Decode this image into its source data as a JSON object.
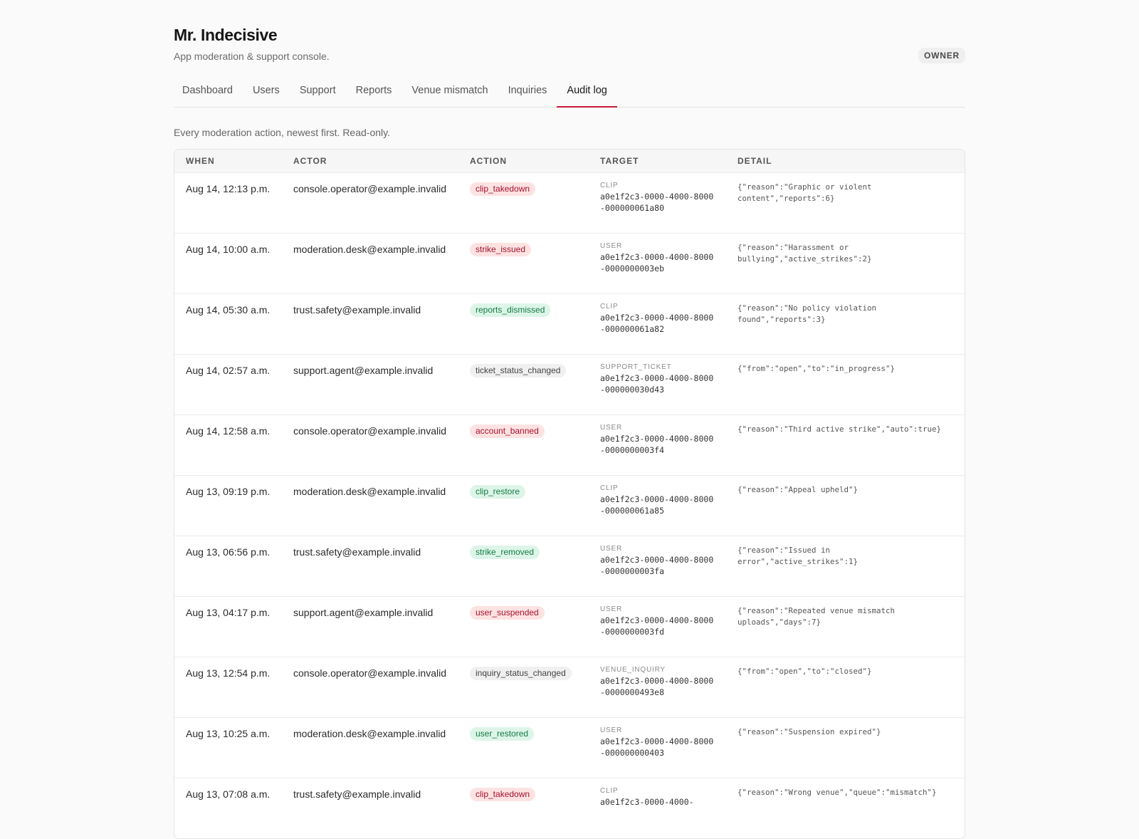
{
  "app": {
    "title": "Mr. Indecisive",
    "subtitle": "App moderation & support console.",
    "role_badge": "OWNER"
  },
  "tabs": [
    {
      "label": "Dashboard",
      "active": false
    },
    {
      "label": "Users",
      "active": false
    },
    {
      "label": "Support",
      "active": false
    },
    {
      "label": "Reports",
      "active": false
    },
    {
      "label": "Venue mismatch",
      "active": false
    },
    {
      "label": "Inquiries",
      "active": false
    },
    {
      "label": "Audit log",
      "active": true
    }
  ],
  "audit": {
    "intro": "Every moderation action, newest first. Read-only.",
    "columns": {
      "when": "WHEN",
      "actor": "ACTOR",
      "action": "ACTION",
      "target": "TARGET",
      "detail": "DETAIL"
    },
    "rows": [
      {
        "when": "Aug 14, 12:13 p.m.",
        "actor": "console.operator@example.invalid",
        "action": "clip_takedown",
        "tone": "red",
        "target_type": "CLIP",
        "target_id": "a0e1f2c3-0000-4000-8000-000000061a80",
        "detail": "{\"reason\":\"Graphic or violent content\",\"reports\":6}"
      },
      {
        "when": "Aug 14, 10:00 a.m.",
        "actor": "moderation.desk@example.invalid",
        "action": "strike_issued",
        "tone": "red",
        "target_type": "USER",
        "target_id": "a0e1f2c3-0000-4000-8000-0000000003eb",
        "detail": "{\"reason\":\"Harassment or bullying\",\"active_strikes\":2}"
      },
      {
        "when": "Aug 14, 05:30 a.m.",
        "actor": "trust.safety@example.invalid",
        "action": "reports_dismissed",
        "tone": "green",
        "target_type": "CLIP",
        "target_id": "a0e1f2c3-0000-4000-8000-000000061a82",
        "detail": "{\"reason\":\"No policy violation found\",\"reports\":3}"
      },
      {
        "when": "Aug 14, 02:57 a.m.",
        "actor": "support.agent@example.invalid",
        "action": "ticket_status_changed",
        "tone": "gray",
        "target_type": "SUPPORT_TICKET",
        "target_id": "a0e1f2c3-0000-4000-8000-000000030d43",
        "detail": "{\"from\":\"open\",\"to\":\"in_progress\"}"
      },
      {
        "when": "Aug 14, 12:58 a.m.",
        "actor": "console.operator@example.invalid",
        "action": "account_banned",
        "tone": "red",
        "target_type": "USER",
        "target_id": "a0e1f2c3-0000-4000-8000-0000000003f4",
        "detail": "{\"reason\":\"Third active strike\",\"auto\":true}"
      },
      {
        "when": "Aug 13, 09:19 p.m.",
        "actor": "moderation.desk@example.invalid",
        "action": "clip_restore",
        "tone": "green",
        "target_type": "CLIP",
        "target_id": "a0e1f2c3-0000-4000-8000-000000061a85",
        "detail": "{\"reason\":\"Appeal upheld\"}"
      },
      {
        "when": "Aug 13, 06:56 p.m.",
        "actor": "trust.safety@example.invalid",
        "action": "strike_removed",
        "tone": "green",
        "target_type": "USER",
        "target_id": "a0e1f2c3-0000-4000-8000-0000000003fa",
        "detail": "{\"reason\":\"Issued in error\",\"active_strikes\":1}"
      },
      {
        "when": "Aug 13, 04:17 p.m.",
        "actor": "support.agent@example.invalid",
        "action": "user_suspended",
        "tone": "red",
        "target_type": "USER",
        "target_id": "a0e1f2c3-0000-4000-8000-0000000003fd",
        "detail": "{\"reason\":\"Repeated venue mismatch uploads\",\"days\":7}"
      },
      {
        "when": "Aug 13, 12:54 p.m.",
        "actor": "console.operator@example.invalid",
        "action": "inquiry_status_changed",
        "tone": "gray",
        "target_type": "VENUE_INQUIRY",
        "target_id": "a0e1f2c3-0000-4000-8000-0000000493e8",
        "detail": "{\"from\":\"open\",\"to\":\"closed\"}"
      },
      {
        "when": "Aug 13, 10:25 a.m.",
        "actor": "moderation.desk@example.invalid",
        "action": "user_restored",
        "tone": "green",
        "target_type": "USER",
        "target_id": "a0e1f2c3-0000-4000-8000-000000000403",
        "detail": "{\"reason\":\"Suspension expired\"}"
      },
      {
        "when": "Aug 13, 07:08 a.m.",
        "actor": "trust.safety@example.invalid",
        "action": "clip_takedown",
        "tone": "red",
        "target_type": "CLIP",
        "target_id": "a0e1f2c3-0000-4000-",
        "detail": "{\"reason\":\"Wrong venue\",\"queue\":\"mismatch\"}"
      }
    ]
  }
}
